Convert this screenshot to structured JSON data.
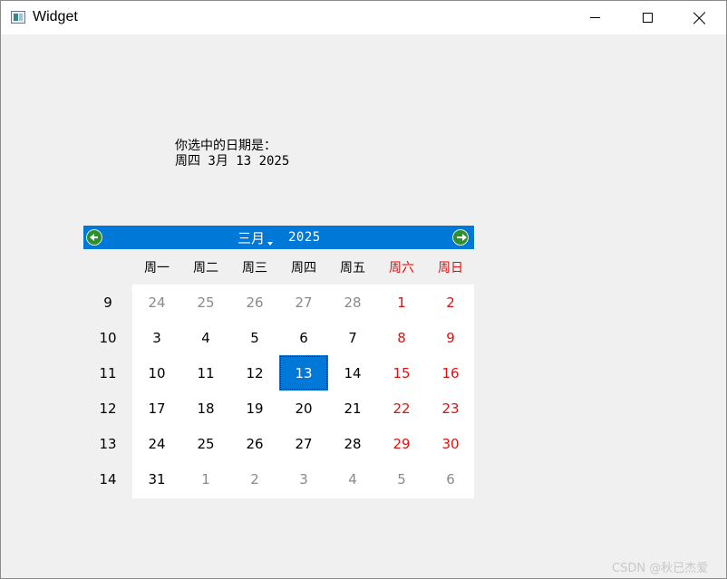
{
  "window": {
    "title": "Widget",
    "icon": "app-window-icon",
    "controls": {
      "minimize": "minimize-icon",
      "maximize": "maximize-icon",
      "close": "close-icon"
    }
  },
  "selection": {
    "label": "你选中的日期是：",
    "value": "周四 3月 13 2025"
  },
  "calendar": {
    "month": "三月",
    "year": "2025",
    "prev_icon": "arrow-left-icon",
    "next_icon": "arrow-right-icon",
    "weekdays": [
      "周一",
      "周二",
      "周三",
      "周四",
      "周五",
      "周六",
      "周日"
    ],
    "weeks": [
      {
        "num": "9",
        "days": [
          "24",
          "25",
          "26",
          "27",
          "28",
          "1",
          "2"
        ]
      },
      {
        "num": "10",
        "days": [
          "3",
          "4",
          "5",
          "6",
          "7",
          "8",
          "9"
        ]
      },
      {
        "num": "11",
        "days": [
          "10",
          "11",
          "12",
          "13",
          "14",
          "15",
          "16"
        ]
      },
      {
        "num": "12",
        "days": [
          "17",
          "18",
          "19",
          "20",
          "21",
          "22",
          "23"
        ]
      },
      {
        "num": "13",
        "days": [
          "24",
          "25",
          "26",
          "27",
          "28",
          "29",
          "30"
        ]
      },
      {
        "num": "14",
        "days": [
          "31",
          "1",
          "2",
          "3",
          "4",
          "5",
          "6"
        ]
      }
    ],
    "selected_date": "13",
    "colors": {
      "accent": "#0078d7",
      "weekend": "#e01010",
      "other_month": "#8a8a8a"
    }
  },
  "watermark": "CSDN @秋已杰爱"
}
